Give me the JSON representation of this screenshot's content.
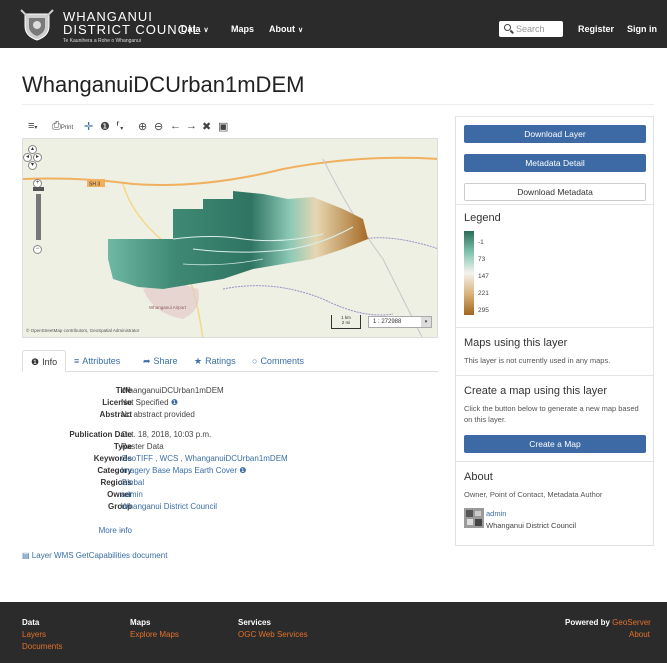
{
  "header": {
    "brand_line1": "WHANGANUI",
    "brand_line2": "DISTRICT COUNCIL",
    "brand_tagline": "Te Kaunihera a Rohe o Whanganui",
    "nav": [
      {
        "label": "Data"
      },
      {
        "label": "Maps"
      },
      {
        "label": "About"
      }
    ],
    "search_placeholder": "Search",
    "register_label": "Register",
    "signin_label": "Sign in"
  },
  "page_title": "WhanganuiDCUrban1mDEM",
  "toolbar": {
    "print_label": "Print"
  },
  "map": {
    "attribution": "© OpenStreetMap contributors, GeoSpatial Administrator",
    "road_label": "SH 3",
    "airport_label": "Whanganui Airport",
    "scale_km": "1 km",
    "scale_mi": "2 mi",
    "scale_value": "1 : 272988"
  },
  "tabs": [
    {
      "label": "Info"
    },
    {
      "label": "Attributes"
    },
    {
      "label": "Share"
    },
    {
      "label": "Ratings"
    },
    {
      "label": "Comments"
    }
  ],
  "info": {
    "title_label": "Title",
    "title_value": "WhanganuiDCUrban1mDEM",
    "license_label": "License",
    "license_value": "Not Specified",
    "abstract_label": "Abstract",
    "abstract_value": "No abstract provided",
    "pubdate_label": "Publication Date",
    "pubdate_value": "Oct. 18, 2018, 10:03 p.m.",
    "type_label": "Type",
    "type_value": "Raster Data",
    "keywords_label": "Keywords",
    "keywords_value": "GeoTIFF , WCS , WhanganuiDCUrban1mDEM",
    "category_label": "Category",
    "category_value": "Imagery Base Maps Earth Cover",
    "regions_label": "Regions",
    "regions_value": "Global",
    "owner_label": "Owner",
    "owner_value": "admin",
    "group_label": "Group",
    "group_value": "Whanganui District Council",
    "moreinfo_label": "More info",
    "moreinfo_value": "-"
  },
  "wms_link": "Layer WMS GetCapabilities document",
  "sidebar": {
    "download_layer": "Download Layer",
    "metadata_detail": "Metadata Detail",
    "download_metadata": "Download Metadata",
    "legend_title": "Legend",
    "legend_values": [
      "-1",
      "73",
      "147",
      "221",
      "295"
    ],
    "legend_colors": [
      "#2a6e5a",
      "#7fc2ae",
      "#f3f3ee",
      "#d9b27a",
      "#a0661f"
    ],
    "maps_title": "Maps using this layer",
    "maps_text": "This layer is not currently used in any maps.",
    "create_title": "Create a map using this layer",
    "create_text": "Click the button below to generate a new map based on this layer.",
    "create_button": "Create a Map",
    "about_title": "About",
    "about_text": "Owner, Point of Contact, Metadata Author",
    "owner_name": "admin",
    "owner_org": "Whanganui District Council"
  },
  "footer": {
    "col1_head": "Data",
    "col1_links": [
      "Layers",
      "Documents"
    ],
    "col2_head": "Maps",
    "col2_links": [
      "Explore Maps"
    ],
    "col3_head": "Services",
    "col3_links": [
      "OGC Web Services"
    ],
    "powered_by": "Powered by",
    "powered_link": "GeoServer",
    "about_link": "About"
  },
  "colors": {
    "nav_bg": "#2b2b2b",
    "primary": "#3d6aa5",
    "link": "#3a6ea5",
    "footer_link": "#e2712a"
  }
}
